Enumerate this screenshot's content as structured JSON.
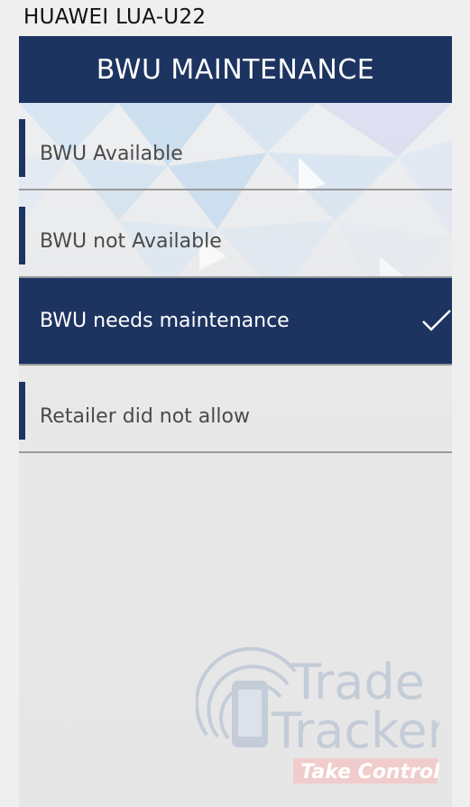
{
  "device": {
    "label": "HUAWEI LUA-U22"
  },
  "header": {
    "title": "BWU MAINTENANCE"
  },
  "options": [
    {
      "label": "BWU Available",
      "selected": false
    },
    {
      "label": "BWU not Available",
      "selected": false
    },
    {
      "label": "BWU needs maintenance",
      "selected": true
    },
    {
      "label": "Retailer did not allow",
      "selected": false
    }
  ],
  "logo": {
    "line1": "Trade",
    "line2": "Tracker",
    "tagline": "Take Control",
    "icon": "phone-signal-icon"
  },
  "colors": {
    "header": "#1d3461",
    "selected": "#1d3461",
    "accent": "#1d3461",
    "divider": "#9a9a9a",
    "tagline_bg": "#f2c7c7"
  }
}
